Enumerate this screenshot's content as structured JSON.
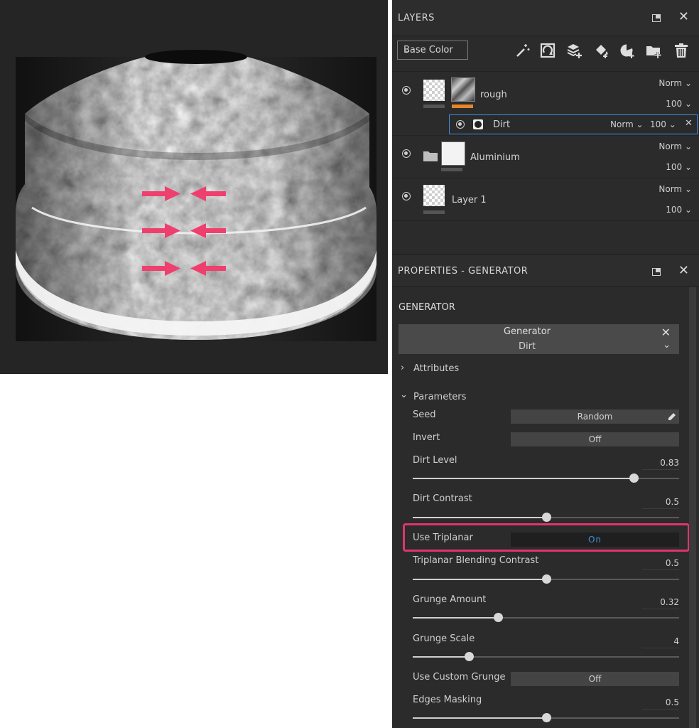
{
  "layers_panel": {
    "title": "LAYERS",
    "channel_select": "Base Color",
    "layers": [
      {
        "name": "rough",
        "blend": "Norm",
        "opacity": "100"
      },
      {
        "name": "Dirt",
        "blend": "Norm",
        "opacity": "100"
      },
      {
        "name": "Aluminium",
        "blend": "Norm",
        "opacity": "100"
      },
      {
        "name": "Layer 1",
        "blend": "Norm",
        "opacity": "100"
      }
    ]
  },
  "properties_panel": {
    "title": "PROPERTIES - GENERATOR",
    "section": "GENERATOR",
    "generator_header": "Generator",
    "generator_name": "Dirt",
    "attributes_label": "Attributes",
    "parameters_label": "Parameters",
    "params": {
      "seed": {
        "label": "Seed",
        "value": "Random"
      },
      "invert": {
        "label": "Invert",
        "value": "Off"
      },
      "dirt_level": {
        "label": "Dirt Level",
        "value": "0.83",
        "fraction": 0.83
      },
      "dirt_contrast": {
        "label": "Dirt Contrast",
        "value": "0.5",
        "fraction": 0.5
      },
      "use_triplanar": {
        "label": "Use Triplanar",
        "value": "On"
      },
      "triplanar_blending": {
        "label": "Triplanar Blending Contrast",
        "value": "0.5",
        "fraction": 0.5
      },
      "grunge_amount": {
        "label": "Grunge Amount",
        "value": "0.32",
        "fraction": 0.32
      },
      "grunge_scale": {
        "label": "Grunge Scale",
        "value": "4",
        "fraction": 0.21
      },
      "use_custom_grunge": {
        "label": "Use Custom Grunge",
        "value": "Off"
      },
      "edges_masking": {
        "label": "Edges Masking",
        "value": "0.5",
        "fraction": 0.5
      }
    }
  },
  "colors": {
    "highlight_box": "#e0356a",
    "arrow": "#ef3f6e",
    "orange_accent": "#e8842a",
    "selection_blue": "#3b8fe0",
    "on_text": "#3d8ed8"
  }
}
